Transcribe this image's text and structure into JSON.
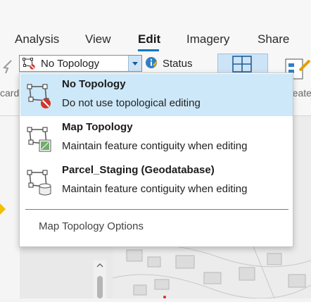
{
  "tabs": [
    {
      "label": "Analysis"
    },
    {
      "label": "View"
    },
    {
      "label": "Edit",
      "active": true
    },
    {
      "label": "Imagery"
    },
    {
      "label": "Share"
    }
  ],
  "topology_combo": {
    "selected": "No Topology"
  },
  "status_button": {
    "label": "Status"
  },
  "ribbon_cut_labels": {
    "left": "card",
    "right": "reate"
  },
  "dropdown": {
    "items": [
      {
        "title": "No Topology",
        "description": "Do not use topological editing",
        "icon": "no-topology-icon",
        "selected": true
      },
      {
        "title": "Map Topology",
        "description": "Maintain feature contiguity when editing",
        "icon": "map-topology-icon"
      },
      {
        "title": "Parcel_Staging (Geodatabase)",
        "description": "Maintain feature contiguity when editing",
        "icon": "geodatabase-topology-icon"
      }
    ],
    "options_label": "Map Topology Options"
  },
  "colors": {
    "accent": "#0079c1",
    "selection": "#cde8f8"
  }
}
